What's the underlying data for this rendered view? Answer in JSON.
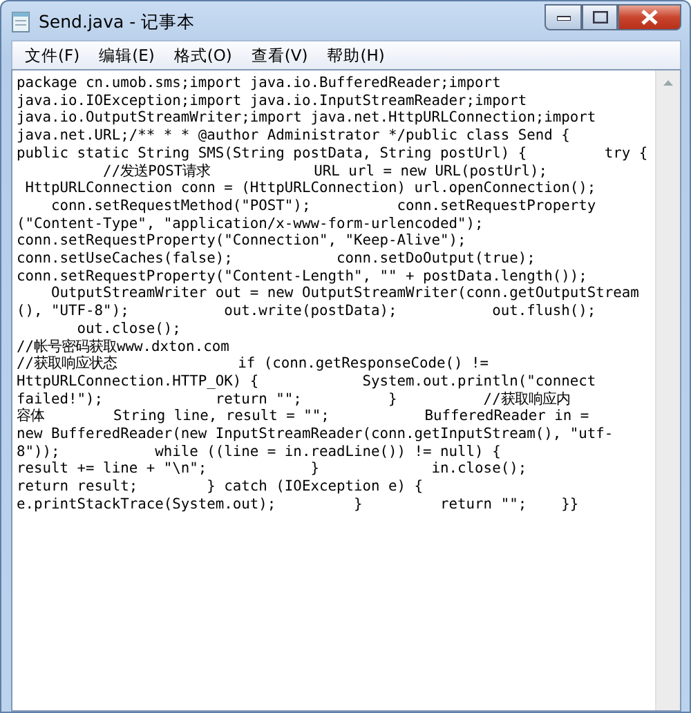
{
  "window": {
    "title": "Send.java - 记事本"
  },
  "menu": [
    {
      "label": "文件(F)"
    },
    {
      "label": "编辑(E)"
    },
    {
      "label": "格式(O)"
    },
    {
      "label": "查看(V)"
    },
    {
      "label": "帮助(H)"
    }
  ],
  "editor": {
    "lines": [
      "package cn.umob.sms;import java.io.BufferedReader;import",
      "java.io.IOException;import java.io.InputStreamReader;import",
      "java.io.OutputStreamWriter;import java.net.HttpURLConnection;import",
      "java.net.URL;/** * * @author Administrator */public class Send {",
      "public static String SMS(String postData, String postUrl) {         try {",
      "          //发送POST请求            URL url = new URL(postUrl);",
      " HttpURLConnection conn = (HttpURLConnection) url.openConnection();",
      "    conn.setRequestMethod(\"POST\");          conn.setRequestProperty",
      "(\"Content-Type\", \"application/x-www-form-urlencoded\");",
      "conn.setRequestProperty(\"Connection\", \"Keep-Alive\");",
      "conn.setUseCaches(false);            conn.setDoOutput(true);",
      "conn.setRequestProperty(\"Content-Length\", \"\" + postData.length());",
      "    OutputStreamWriter out = new OutputStreamWriter(conn.getOutputStream",
      "(), \"UTF-8\");           out.write(postData);           out.flush();",
      "       out.close();",
      "//帐号密码获取www.dxton.com",
      "//获取响应状态              if (conn.getResponseCode() !=",
      "HttpURLConnection.HTTP_OK) {            System.out.println(\"connect",
      "failed!\");             return \"\";          }          //获取响应内",
      "容体        String line, result = \"\";           BufferedReader in =",
      "new BufferedReader(new InputStreamReader(conn.getInputStream(), \"utf-",
      "8\"));           while ((line = in.readLine()) != null) {",
      "result += line + \"\\n\";            }             in.close();",
      "return result;        } catch (IOException e) {",
      "e.printStackTrace(System.out);         }         return \"\";    }}"
    ]
  }
}
